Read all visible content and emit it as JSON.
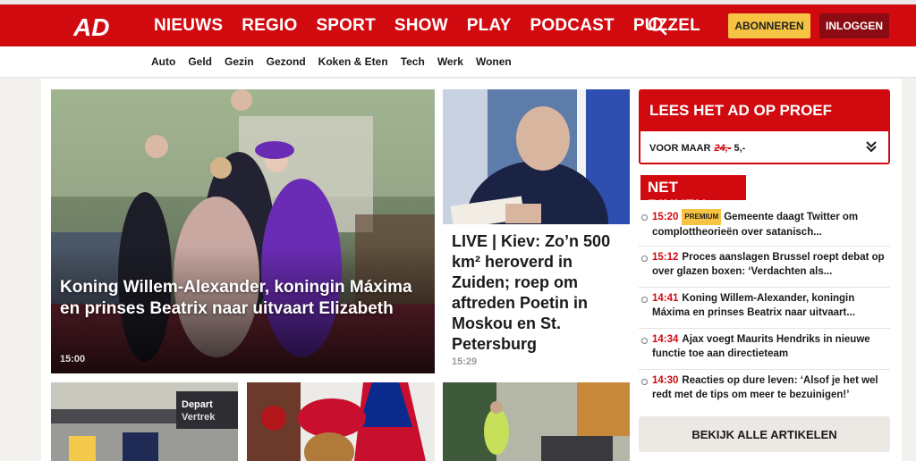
{
  "brand": {
    "logo_text": "AD",
    "accent": "#d10a10",
    "sub_color": "#f6c343"
  },
  "header": {
    "nav": [
      "NIEUWS",
      "REGIO",
      "SPORT",
      "SHOW",
      "PLAY",
      "PODCAST",
      "PUZZEL"
    ],
    "subscribe_label": "ABONNEREN",
    "login_label": "INLOGGEN"
  },
  "subnav": [
    "Auto",
    "Geld",
    "Gezin",
    "Gezond",
    "Koken & Eten",
    "Tech",
    "Werk",
    "Wonen"
  ],
  "hero": {
    "title": "Koning Willem-Alexander, koningin Máxima en prinses Beatrix naar uitvaart Elizabeth",
    "time": "15:00"
  },
  "second": {
    "title": "LIVE | Kiev: Zo’n 500 km² heroverd in Zuiden; roep om aftreden Poetin in Moskou en St. Petersburg",
    "time": "15:29"
  },
  "promo": {
    "title": "LEES HET AD OP PROEF",
    "prefix": "VOOR MAAR",
    "old_price": "24,-",
    "new_price": "5,-"
  },
  "net_binnen": {
    "title": "NET BINNEN",
    "items": [
      {
        "time": "15:20",
        "badge": "PREMIUM",
        "text": "Gemeente daagt Twitter om complottheorieën over satanisch..."
      },
      {
        "time": "15:12",
        "badge": "",
        "text": "Proces aanslagen Brussel roept debat op over glazen boxen: ‘Verdachten als..."
      },
      {
        "time": "14:41",
        "badge": "",
        "text": "Koning Willem-Alexander, koningin Máxima en prinses Beatrix naar uitvaart..."
      },
      {
        "time": "14:34",
        "badge": "",
        "text": "Ajax voegt Maurits Hendriks in nieuwe functie toe aan directieteam"
      },
      {
        "time": "14:30",
        "badge": "",
        "text": "Reacties op dure leven: ‘Alsof je het wel redt met de tips om meer te bezuinigen!’"
      }
    ],
    "all_label": "BEKIJK ALLE ARTIKELEN"
  },
  "thumbs": {
    "airport_sign": "Depart Vertrek"
  }
}
